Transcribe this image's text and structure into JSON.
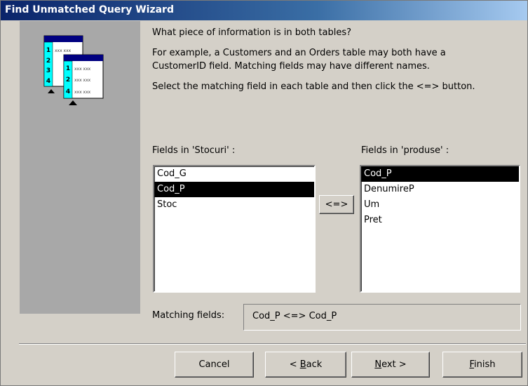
{
  "window": {
    "title": "Find Unmatched Query Wizard"
  },
  "illustration": {
    "back_numbers": [
      "1",
      "2",
      "3",
      "4"
    ],
    "front_numbers": [
      "1",
      "2",
      "4"
    ],
    "cell_text": "xxx xxx"
  },
  "intro": {
    "question": "What piece of information is in both tables?",
    "example_line1": "For example, a Customers and an Orders table may both have a",
    "example_line2": "CustomerID field. Matching fields may have different names.",
    "instruction": "Select the matching field in each table and then click the <=> button."
  },
  "left_list": {
    "label": "Fields in 'Stocuri' :",
    "items": [
      "Cod_G",
      "Cod_P",
      "Stoc"
    ],
    "selected": "Cod_P"
  },
  "right_list": {
    "label": "Fields in 'produse' :",
    "items": [
      "Cod_P",
      "DenumireP",
      "Um",
      "Pret"
    ],
    "selected": "Cod_P"
  },
  "match_button_label": "<=>",
  "matching": {
    "label": "Matching fields:",
    "value": "Cod_P <=> Cod_P"
  },
  "buttons": {
    "cancel": "Cancel",
    "back_prefix": "< ",
    "back_mnemonic": "B",
    "back_rest": "ack",
    "next_mnemonic": "N",
    "next_rest": "ext >",
    "finish_mnemonic": "F",
    "finish_rest": "inish"
  },
  "colors": {
    "title_bar": "#0a246a",
    "dialog_face": "#d4d0c8",
    "side_panel": "#a8a8a8",
    "illustration_cyan": "#00ffff",
    "illustration_header": "#000080",
    "selection": "#000000"
  }
}
